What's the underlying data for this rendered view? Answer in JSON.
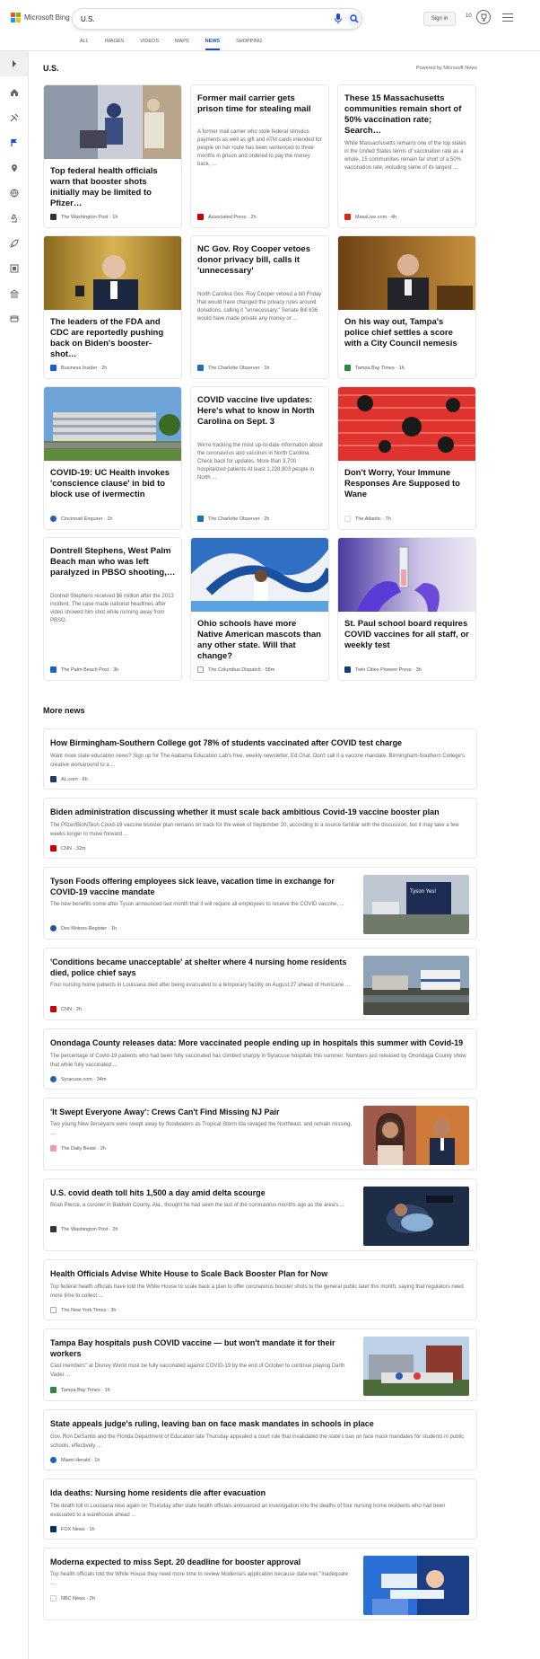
{
  "header": {
    "brand": "Microsoft Bing",
    "search_value": "U.S.",
    "signin_label": "Sign in",
    "rewards_count": "10"
  },
  "tabs": [
    {
      "label": "ALL"
    },
    {
      "label": "IMAGES"
    },
    {
      "label": "VIDEOS"
    },
    {
      "label": "MAPS"
    },
    {
      "label": "NEWS"
    },
    {
      "label": "SHOPPING"
    }
  ],
  "colors": {
    "accent": "#174ae4",
    "ms_red": "#f25022",
    "ms_green": "#7fba00",
    "ms_blue": "#00a4ef",
    "ms_yellow": "#ffb900"
  },
  "rail_icons": [
    "chevron-right-icon",
    "home-icon",
    "tools-icon",
    "flag-icon",
    "location-icon",
    "globe-icon",
    "microscope-icon",
    "rocket-icon",
    "film-icon",
    "bank-icon",
    "card-icon"
  ],
  "section": {
    "title": "U.S.",
    "powered_by": "Powered by Microsoft News"
  },
  "cards": [
    {
      "title": "Top federal health officials warn that booster shots initially may be limited to Pfizer…",
      "snippet": "",
      "source": "The Washington Post",
      "time": "1h",
      "logo": "wp"
    },
    {
      "title": "Former mail carrier gets prison time for stealing mail",
      "snippet": "A former mail carrier who stole federal stimulus payments as well as gift and ATM cards intended for people on her route has been sentenced to three months in prison and ordered to pay the money back, ...",
      "source": "Associated Press",
      "time": "2h",
      "logo": "AP"
    },
    {
      "title": "These 15 Massachusetts communities remain short of 50% vaccination rate; Search…",
      "snippet": "While Massachusetts remains one of the top states in the United States terms of vaccination rate as a whole, 15 communities remain far short of a 50% vaccination rate, including some of its largest ...",
      "source": "MassLive.com",
      "time": "4h",
      "logo": "M"
    },
    {
      "title": "The leaders of the FDA and CDC are reportedly pushing back on Biden's booster-shot…",
      "snippet": "",
      "source": "Business Insider",
      "time": "2h",
      "logo": "BI"
    },
    {
      "title": "NC Gov. Roy Cooper vetoes donor privacy bill, calls it 'unnecessary'",
      "snippet": "North Carolina Gov. Roy Cooper vetoed a bill Friday that would have changed the privacy rules around donations, calling it \"unnecessary.\" Senate Bill 636 would have made private any money or ...",
      "source": "The Charlotte Observer",
      "time": "1h",
      "logo": "C"
    },
    {
      "title": "On his way out, Tampa's police chief settles a score with a City Council nemesis",
      "snippet": "",
      "source": "Tampa Bay Times",
      "time": "1h",
      "logo": "T"
    },
    {
      "title": "COVID-19: UC Health invokes 'conscience clause' in bid to block use of ivermectin",
      "snippet": "",
      "source": "Cincinnati Enquirer",
      "time": "1h",
      "logo": "CE"
    },
    {
      "title": "COVID vaccine live updates: Here's what to know in North Carolina on Sept. 3",
      "snippet": "We're tracking the most up-to-date information about the coronavirus and vaccines in North Carolina. Check back for updates. More than 3,700 hospitalized patients At least 1,228,803 people in North ...",
      "source": "The Charlotte Observer",
      "time": "2h",
      "logo": "C"
    },
    {
      "title": "Don't Worry, Your Immune Responses Are Supposed to Wane",
      "snippet": "",
      "source": "The Atlantic",
      "time": "7h",
      "logo": "A"
    },
    {
      "title": "Dontrell Stephens, West Palm Beach man who was left paralyzed in PBSO shooting,…",
      "snippet": "Dontrell Stephens received $6 million after the 2013 incident. The case made national headlines after video showed him shot while running away from PBSO.",
      "source": "The Palm Beach Post",
      "time": "3h",
      "logo": "P"
    },
    {
      "title": "Ohio schools have more Native American mascots than any other state. Will that change?",
      "snippet": "",
      "source": "The Columbus Dispatch",
      "time": "58m",
      "logo": "D"
    },
    {
      "title": "St. Paul school board requires COVID vaccines for all staff, or weekly test",
      "snippet": "",
      "source": "Twin Cities Pioneer Press",
      "time": "3h",
      "logo": "PP"
    }
  ],
  "more_news": {
    "title": "More news",
    "items": [
      {
        "title": "How Birmingham-Southern College got 78% of students vaccinated after COVID test charge",
        "snippet": "Want more state education news? Sign up for The Alabama Education Lab's free, weekly newsletter, Ed Chat. Don't call it a vaccine mandate. Birmingham-Southern College's creative workaround to a ...",
        "source": "AL.com",
        "time": "6h",
        "logo": "AL"
      },
      {
        "title": "Biden administration discussing whether it must scale back ambitious Covid-19 vaccine booster plan",
        "snippet": "The Pfizer/BioNTech Covid-19 vaccine booster plan remains on track for the week of September 20, according to a source familiar with the discussion, but it may take a few weeks longer to move forward ...",
        "source": "CNN",
        "time": "32m",
        "logo": "CNN"
      },
      {
        "title": "Tyson Foods offering employees sick leave, vacation time in exchange for COVID-19 vaccine mandate",
        "snippet": "The new benefits come after Tyson announced last month that it will require all employees to receive the COVID vaccine, ...",
        "source": "Des Moines Register",
        "time": "1h",
        "logo": "DM"
      },
      {
        "title": "'Conditions became unacceptable' at shelter where 4 nursing home residents died, police chief says",
        "snippet": "Four nursing home patients in Louisiana died after being evacuated to a temporary facility on August 27 ahead of Hurricane ...",
        "source": "CNN",
        "time": "2h",
        "logo": "CNN"
      },
      {
        "title": "Onondaga County releases data: More vaccinated people ending up in hospitals this summer with Covid-19",
        "snippet": "The percentage of Covid-19 patients who had been fully vaccinated has climbed sharply in Syracuse hospitals this summer. Numbers just released by Onondaga County show that while fully vaccinated ...",
        "source": "Syracuse.com",
        "time": "34m",
        "logo": "S"
      },
      {
        "title": "'It Swept Everyone Away': Crews Can't Find Missing NJ Pair",
        "snippet": "Two young New Jerseyans were swept away by floodwaters as Tropical Storm Ida ravaged the Northeast, and remain missing, ...",
        "source": "The Daily Beast",
        "time": "2h",
        "logo": "DB"
      },
      {
        "title": "U.S. covid death toll hits 1,500 a day amid delta scourge",
        "snippet": "Brian Pierce, a coroner in Baldwin County, Ala., thought he had seen the last of the coronavirus months ago as the area's ...",
        "source": "The Washington Post",
        "time": "2h",
        "logo": "wp"
      },
      {
        "title": "Health Officials Advise White House to Scale Back Booster Plan for Now",
        "snippet": "Top federal health officials have told the White House to scale back a plan to offer coronavirus booster shots to the general public later this month, saying that regulators need more time to collect ...",
        "source": "The New York Times",
        "time": "3h",
        "logo": "T"
      },
      {
        "title": "Tampa Bay hospitals push COVID vaccine — but won't mandate it for their workers",
        "snippet": "Cast members\" at Disney World must be fully vaccinated against COVID-19 by the end of October to continue playing Darth Vader ...",
        "source": "Tampa Bay Times",
        "time": "1h",
        "logo": "T"
      },
      {
        "title": "State appeals judge's ruling, leaving ban on face mask mandates in schools in place",
        "snippet": "Gov. Ron DeSantis and the Florida Department of Education late Thursday appealed a court rule that invalidated the state's ban on face mask mandates for students in public schools, effectively ...",
        "source": "Miami Herald",
        "time": "1h",
        "logo": "M"
      },
      {
        "title": "Ida deaths: Nursing home residents die after evacuation",
        "snippet": "The death toll in Louisiana rose again on Thursday after state health officials announced an investigation into the deaths of four nursing home residents who had been evacuated to a warehouse ahead ...",
        "source": "FOX News",
        "time": "1h",
        "logo": "F"
      },
      {
        "title": "Moderna expected to miss Sept. 20 deadline for booster approval",
        "snippet": "Top health officials told the White House they need more time to review Moderna's application because data was \"inadequate ...",
        "source": "NBC News",
        "time": "2h",
        "logo": "N"
      }
    ]
  },
  "image_text": {
    "tyson_sign": "Tyson Yes!"
  }
}
